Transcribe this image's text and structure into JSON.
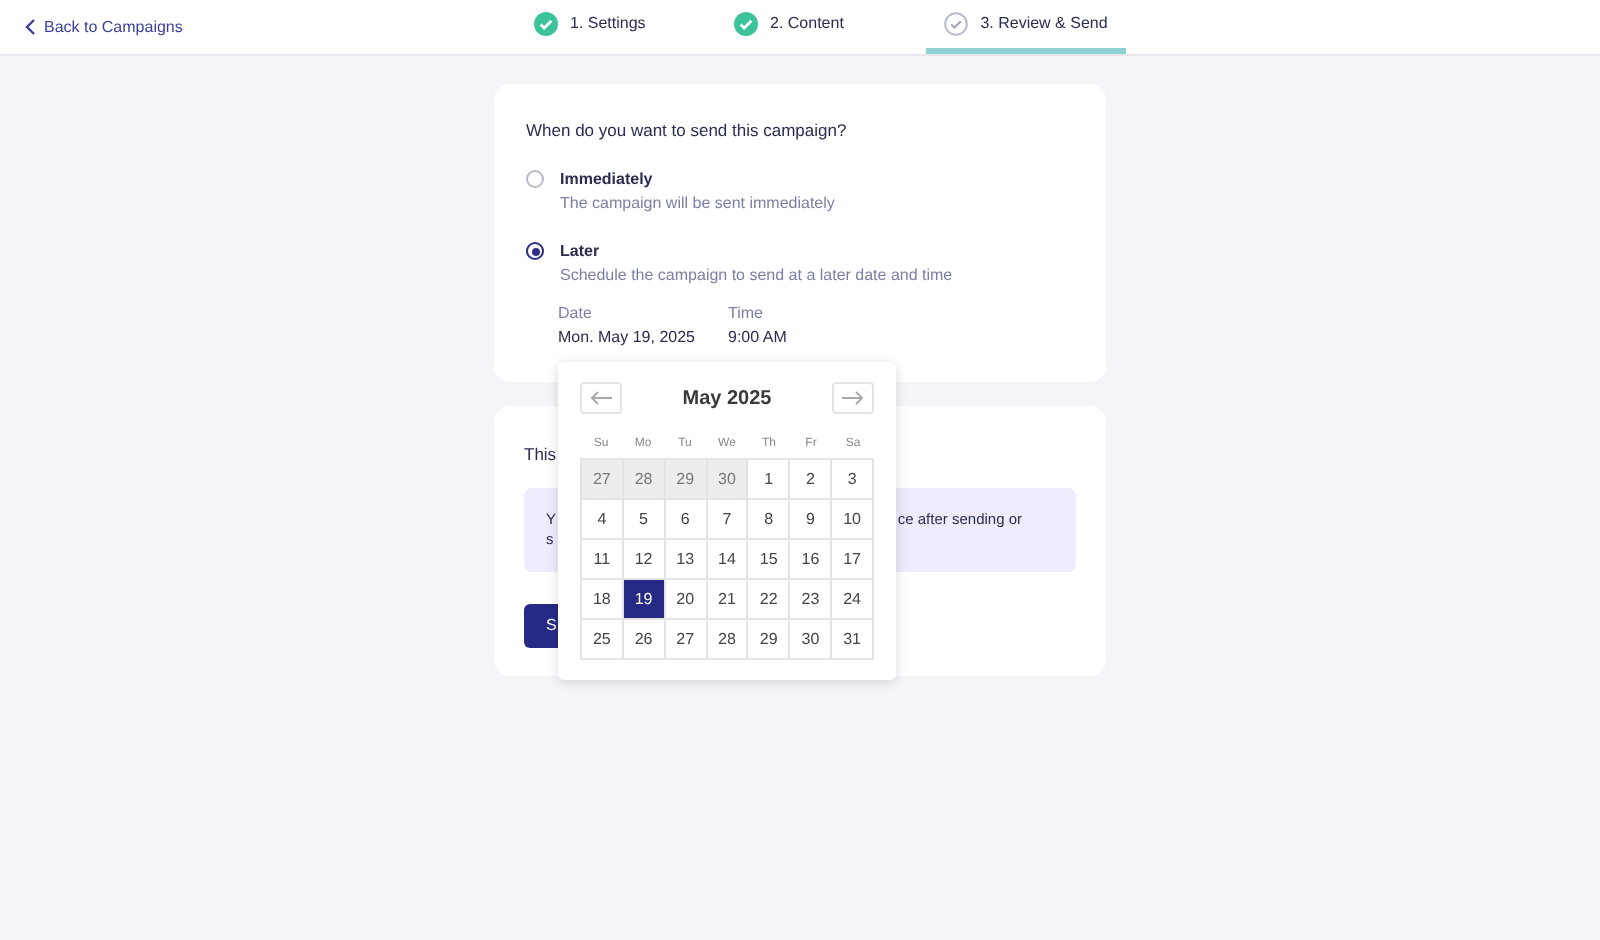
{
  "back_link": "Back to Campaigns",
  "steps": [
    {
      "label": "1. Settings",
      "done": true,
      "selected": false
    },
    {
      "label": "2. Content",
      "done": true,
      "selected": false
    },
    {
      "label": "3. Review & Send",
      "done": false,
      "selected": true
    }
  ],
  "schedule": {
    "question": "When do you want to send this campaign?",
    "options": [
      {
        "label": "Immediately",
        "description": "The campaign will be sent immediately",
        "selected": false
      },
      {
        "label": "Later",
        "description": "Schedule the campaign to send at a later date and time",
        "selected": true
      }
    ],
    "date": {
      "label": "Date",
      "value": "Mon. May 19, 2025"
    },
    "time": {
      "label": "Time",
      "value": "9:00 AM"
    }
  },
  "confirm": {
    "heading": "This",
    "notice_left": [
      "Y",
      "s"
    ],
    "notice_right": "ce after sending or",
    "button": "S"
  },
  "calendar": {
    "month": "May 2025",
    "weekdays": [
      "Su",
      "Mo",
      "Tu",
      "We",
      "Th",
      "Fr",
      "Sa"
    ],
    "weeks": [
      [
        {
          "day": "27",
          "outside": true,
          "selected": false
        },
        {
          "day": "28",
          "outside": true,
          "selected": false
        },
        {
          "day": "29",
          "outside": true,
          "selected": false
        },
        {
          "day": "30",
          "outside": true,
          "selected": false
        },
        {
          "day": "1",
          "outside": false,
          "selected": false
        },
        {
          "day": "2",
          "outside": false,
          "selected": false
        },
        {
          "day": "3",
          "outside": false,
          "selected": false
        }
      ],
      [
        {
          "day": "4",
          "outside": false,
          "selected": false
        },
        {
          "day": "5",
          "outside": false,
          "selected": false
        },
        {
          "day": "6",
          "outside": false,
          "selected": false
        },
        {
          "day": "7",
          "outside": false,
          "selected": false
        },
        {
          "day": "8",
          "outside": false,
          "selected": false
        },
        {
          "day": "9",
          "outside": false,
          "selected": false
        },
        {
          "day": "10",
          "outside": false,
          "selected": false
        }
      ],
      [
        {
          "day": "11",
          "outside": false,
          "selected": false
        },
        {
          "day": "12",
          "outside": false,
          "selected": false
        },
        {
          "day": "13",
          "outside": false,
          "selected": false
        },
        {
          "day": "14",
          "outside": false,
          "selected": false
        },
        {
          "day": "15",
          "outside": false,
          "selected": false
        },
        {
          "day": "16",
          "outside": false,
          "selected": false
        },
        {
          "day": "17",
          "outside": false,
          "selected": false
        }
      ],
      [
        {
          "day": "18",
          "outside": false,
          "selected": false
        },
        {
          "day": "19",
          "outside": false,
          "selected": true
        },
        {
          "day": "20",
          "outside": false,
          "selected": false
        },
        {
          "day": "21",
          "outside": false,
          "selected": false
        },
        {
          "day": "22",
          "outside": false,
          "selected": false
        },
        {
          "day": "23",
          "outside": false,
          "selected": false
        },
        {
          "day": "24",
          "outside": false,
          "selected": false
        }
      ],
      [
        {
          "day": "25",
          "outside": false,
          "selected": false
        },
        {
          "day": "26",
          "outside": false,
          "selected": false
        },
        {
          "day": "27",
          "outside": false,
          "selected": false
        },
        {
          "day": "28",
          "outside": false,
          "selected": false
        },
        {
          "day": "29",
          "outside": false,
          "selected": false
        },
        {
          "day": "30",
          "outside": false,
          "selected": false
        },
        {
          "day": "31",
          "outside": false,
          "selected": false
        }
      ]
    ]
  }
}
